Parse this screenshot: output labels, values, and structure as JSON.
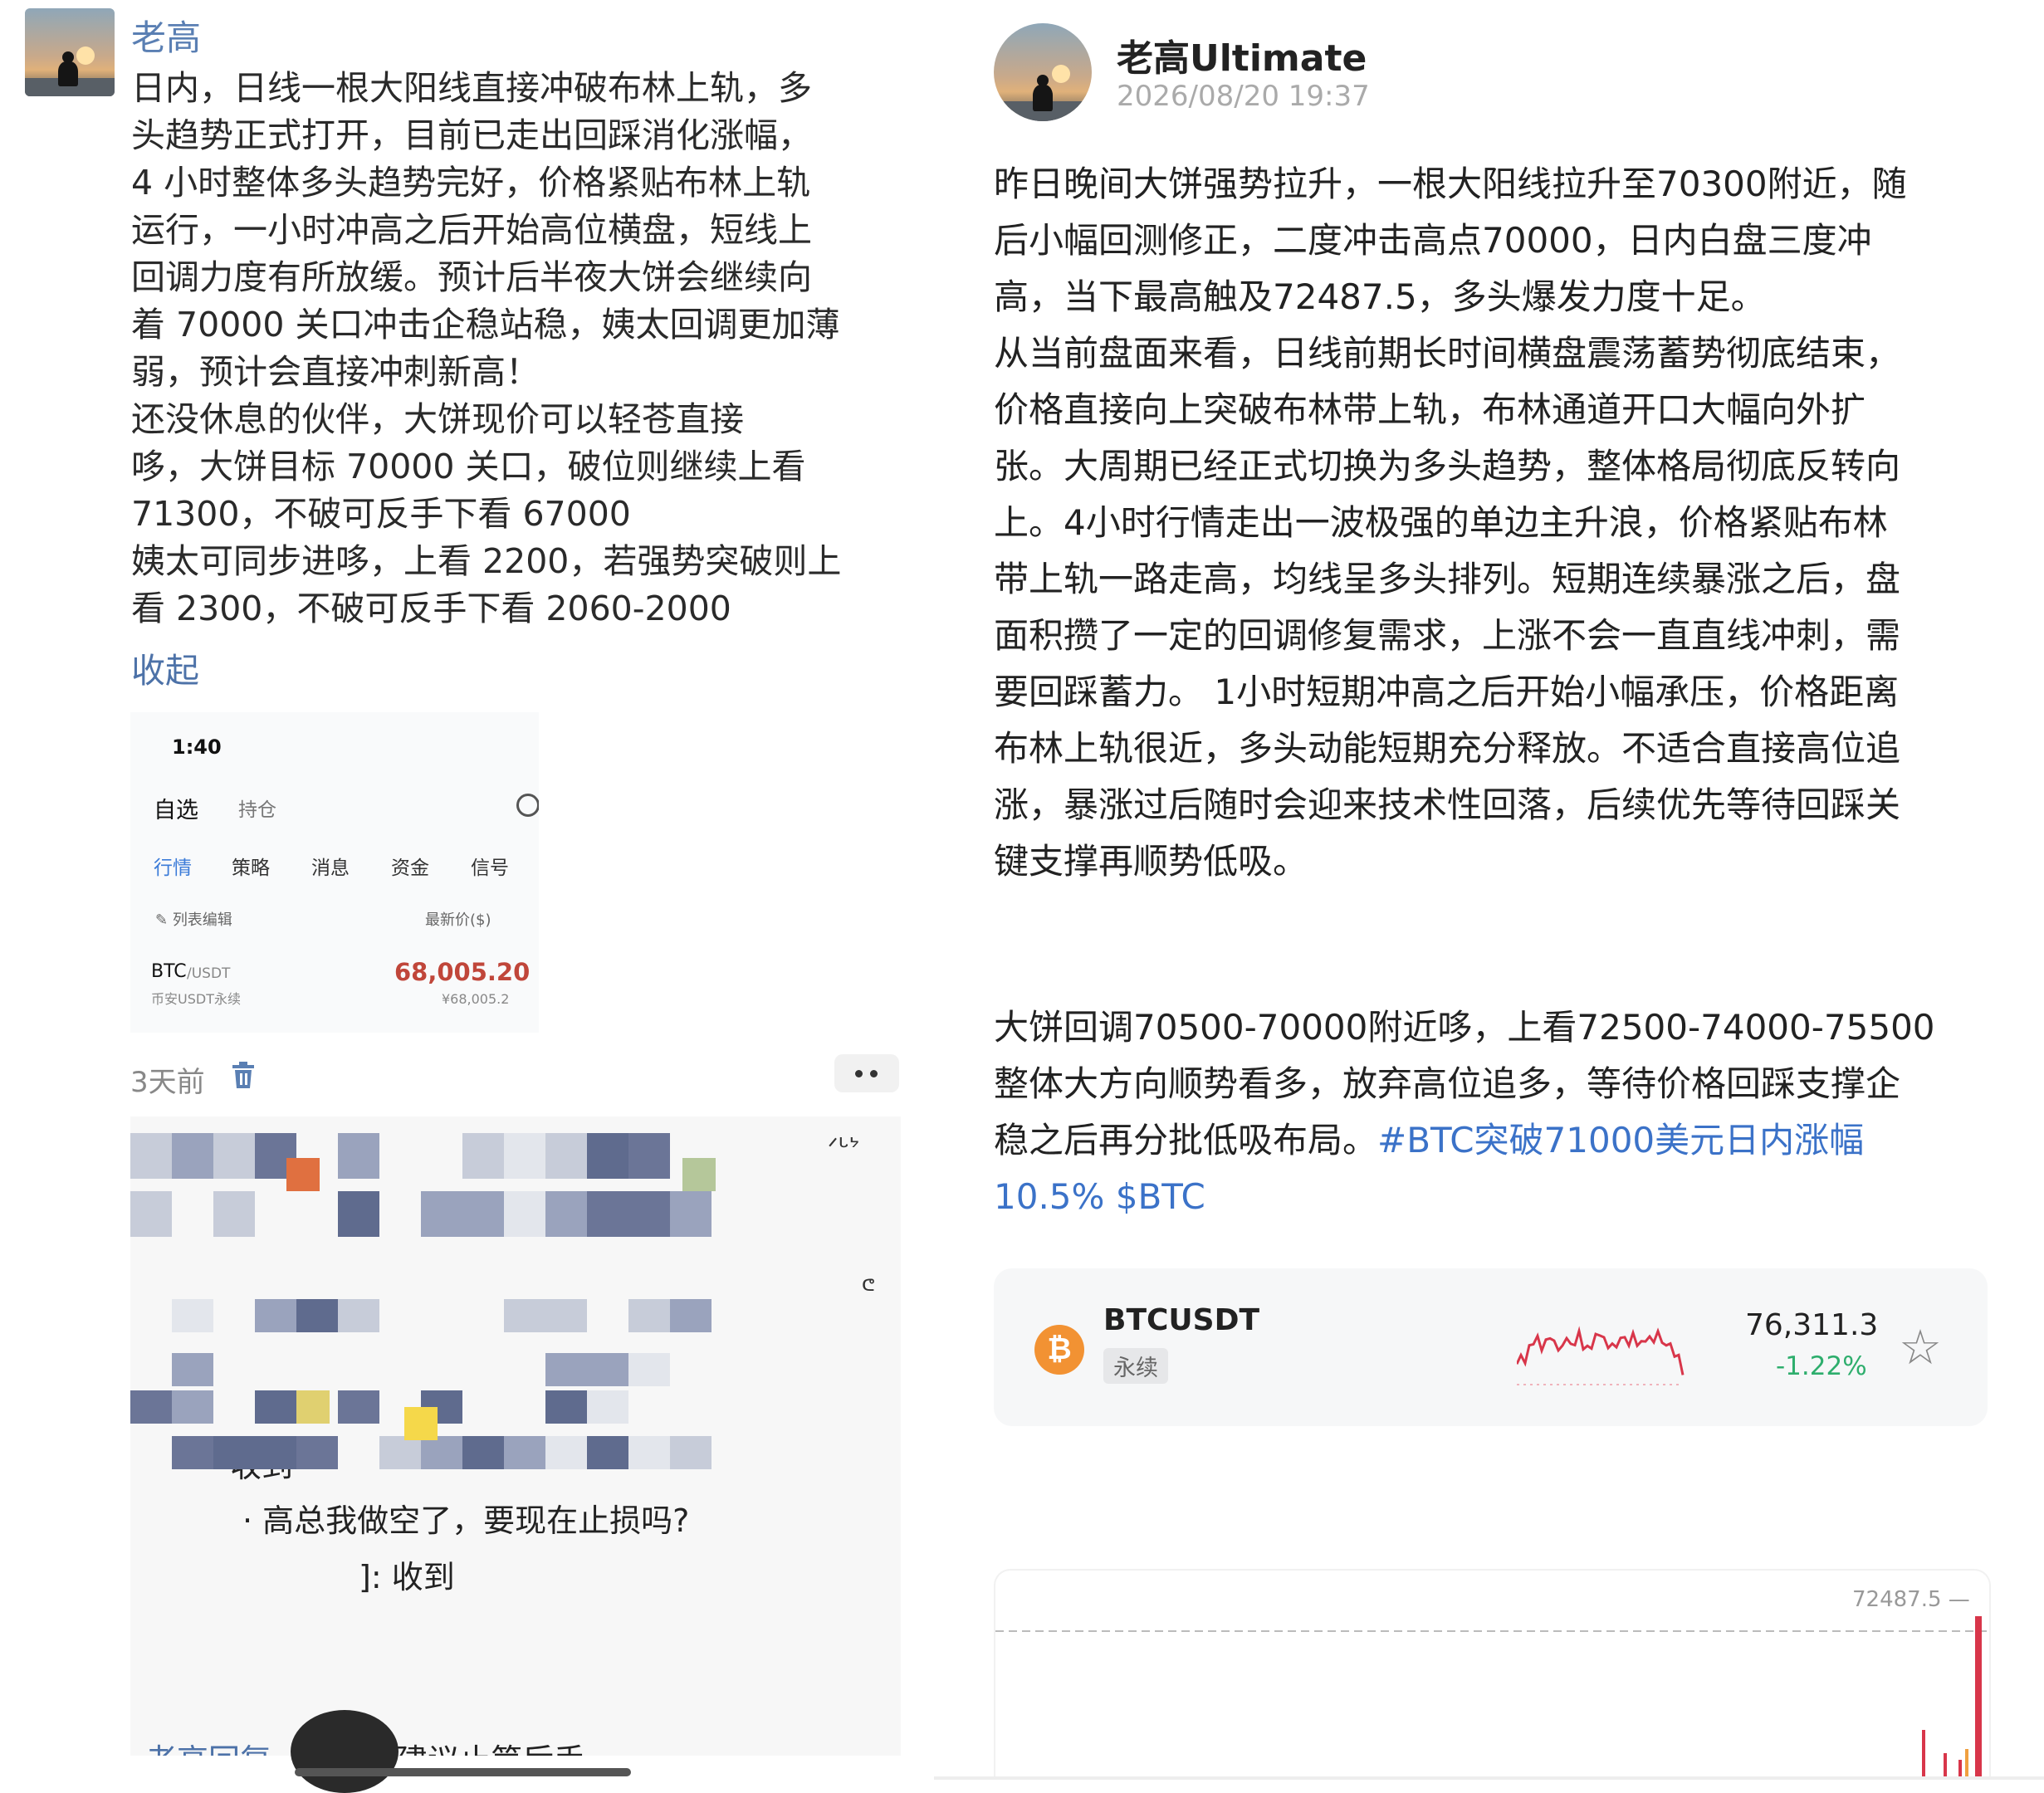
{
  "left": {
    "author": "老高",
    "post_lines": [
      "日内，日线一根大阳线直接冲破布林上轨，多",
      "头趋势正式打开，目前已走出回踩消化涨幅，",
      "4 小时整体多头趋势完好，价格紧贴布林上轨",
      "运行，一小时冲高之后开始高位横盘，短线上",
      "回调力度有所放缓。预计后半夜大饼会继续向",
      "着 70000 关口冲击企稳站稳，姨太回调更加薄",
      "弱，预计会直接冲刺新高！",
      "还没休息的伙伴，大饼现价可以轻苍直接",
      "哆，大饼目标 70000 关口，破位则继续上看",
      "71300，不破可反手下看 67000",
      "姨太可同步进哆，上看 2200，若强势突破则上",
      "看 2300，不破可反手下看 2060-2000"
    ],
    "collapse_label": "收起",
    "phone": {
      "time": "1:40",
      "tab_watchlist": "自选",
      "tab_positions": "持仓",
      "nav": [
        "行情",
        "策略",
        "消息",
        "资金",
        "信号"
      ],
      "edit_list": "列表编辑",
      "latest_price_col": "最新价($)",
      "symbol": "BTC",
      "symbol_quote": "/USDT",
      "market": "币安USDT永续",
      "price": "68,005.20",
      "price_cny": "¥68,005.2"
    },
    "time_ago": "3天前",
    "chat_lines": [
      "收到",
      "高总我做空了，要现在止损吗?",
      "]: 收到",
      "老高回复",
      "建议止第后手"
    ],
    "chat_scribble_top": "ᐟᒡᔾ",
    "chat_scribble_side": "ᕪ"
  },
  "right": {
    "author": "老高Ultimate",
    "date": "2026/08/20 19:37",
    "post_lines": [
      "昨日晚间大饼强势拉升，一根大阳线拉升至70300附近，随",
      "后小幅回测修正，二度冲击高点70000，日内白盘三度冲",
      "高，当下最高触及72487.5，多头爆发力度十足。",
      "从当前盘面来看，日线前期长时间横盘震荡蓄势彻底结束，",
      "价格直接向上突破布林带上轨，布林通道开口大幅向外扩",
      "张。大周期已经正式切换为多头趋势，整体格局彻底反转向",
      "上。4小时行情走出一波极强的单边主升浪，价格紧贴布林",
      "带上轨一路走高，均线呈多头排列。短期连续暴涨之后，盘",
      "面积攒了一定的回调修复需求，上涨不会一直直线冲刺，需",
      "要回踩蓄力。 1小时短期冲高之后开始小幅承压，价格距离",
      "布林上轨很近，多头动能短期充分释放。不适合直接高位追",
      "涨，暴涨过后随时会迎来技术性回落，后续优先等待回踩关",
      "键支撑再顺势低吸。"
    ],
    "post2_lines": [
      "大饼回调70500-70000附近哆，上看72500-74000-75500",
      "整体大方向顺势看多，放弃高位追多，等待价格回踩支撑企",
      "稳之后再分批低吸布局。"
    ],
    "hashtag": "#BTC突破71000美元日内涨幅",
    "hashtag2": "10.5% $BTC",
    "card": {
      "icon": "₿",
      "symbol": "BTCUSDT",
      "type": "永续",
      "price": "76,311.3",
      "change": "-1.22%",
      "star_icon": "☆"
    },
    "bottom_chart_label": "72487.5 —"
  },
  "colors": {
    "link": "#3b72c8",
    "down_green": "#2eae6d",
    "price_red": "#c0463a",
    "btc_orange": "#f29233",
    "sparkline": "#d8364a"
  }
}
